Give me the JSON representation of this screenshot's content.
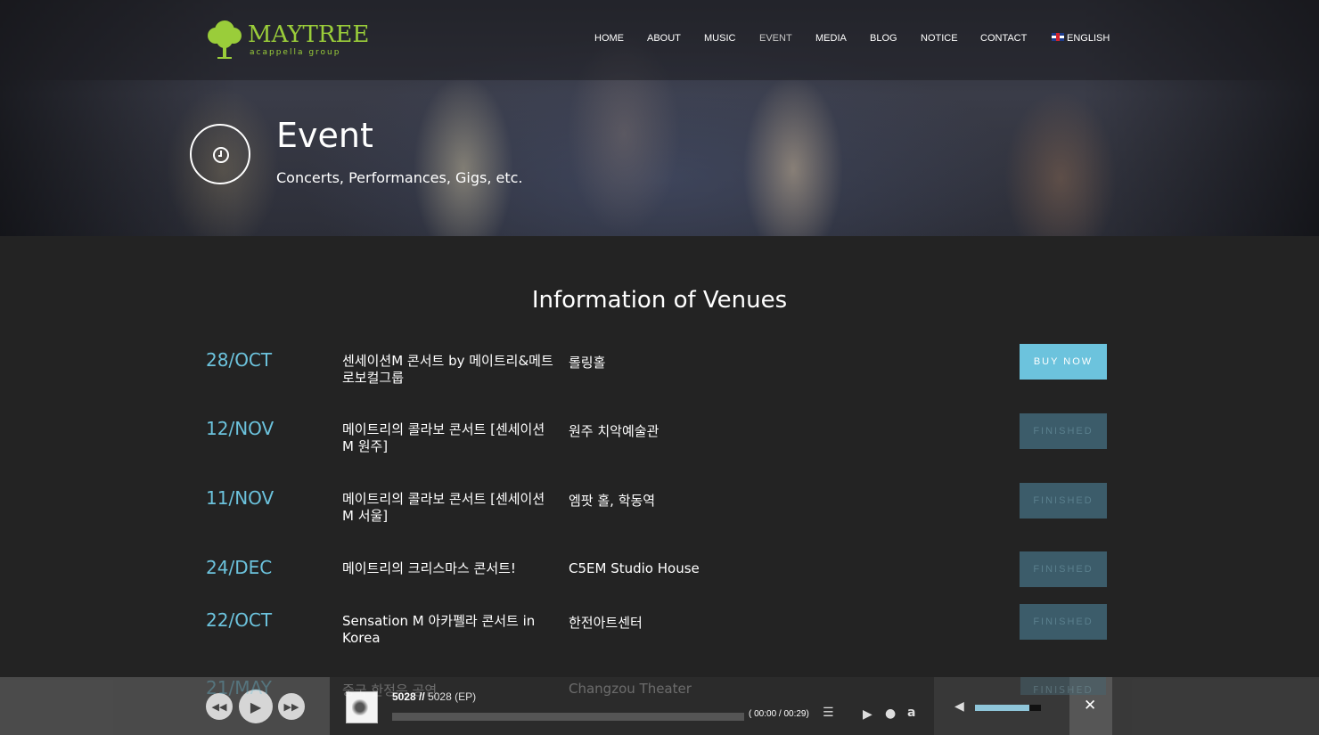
{
  "brand": {
    "name": "MAYTREE",
    "tagline": "acappella group",
    "color": "#9acd3a"
  },
  "nav": {
    "items": [
      {
        "label": "HOME"
      },
      {
        "label": "ABOUT"
      },
      {
        "label": "MUSIC"
      },
      {
        "label": "EVENT",
        "active": true
      },
      {
        "label": "MEDIA"
      },
      {
        "label": "BLOG"
      },
      {
        "label": "NOTICE"
      },
      {
        "label": "CONTACT"
      },
      {
        "label": "ENGLISH",
        "icon": "uk-flag-icon"
      }
    ]
  },
  "hero": {
    "title": "Event",
    "subtitle": "Concerts, Performances, Gigs, etc.",
    "icon": "clock-icon"
  },
  "venues": {
    "heading": "Information of Venues",
    "accent_color": "#6cc3dd",
    "rows": [
      {
        "date": "28/OCT",
        "title": "센세이션M 콘서트 by 메이트리&메트로보컬그룹",
        "venue": "롤링홀",
        "button": "BUY NOW",
        "status": "buy"
      },
      {
        "date": "12/NOV",
        "title": "메이트리의 콜라보 콘서트 [센세이션 M 원주]",
        "venue": "원주 치악예술관",
        "button": "FINISHED",
        "status": "finished"
      },
      {
        "date": "11/NOV",
        "title": "메이트리의 콜라보 콘서트 [센세이션 M 서울]",
        "venue": "엠팟 홀, 학동역",
        "button": "FINISHED",
        "status": "finished"
      },
      {
        "date": "24/DEC",
        "title": "메이트리의 크리스마스 콘서트!",
        "venue": "C5EM Studio House",
        "button": "FINISHED",
        "status": "finished"
      },
      {
        "date": "22/OCT",
        "title": "Sensation M 아카펠라 콘서트 in Korea",
        "venue": "한전아트센터",
        "button": "FINISHED",
        "status": "finished"
      }
    ],
    "partial_row": {
      "date": "21/MAY",
      "title": "중국 한정은 공연",
      "venue": "Changzou Theater",
      "button": "FINISHED"
    }
  },
  "player": {
    "track_number": "5028",
    "separator": "//",
    "track_title": "5028 (EP)",
    "time": "( 00:00 / 00:29)",
    "progress": 0,
    "volume": 0.82,
    "controls": [
      "rewind-icon",
      "play-icon",
      "fast-forward-icon"
    ],
    "links": [
      "playlist-icon",
      "google-play-icon",
      "apple-icon",
      "amazon-icon"
    ],
    "volume_icon": "volume-icon",
    "close_icon": "close-icon"
  }
}
